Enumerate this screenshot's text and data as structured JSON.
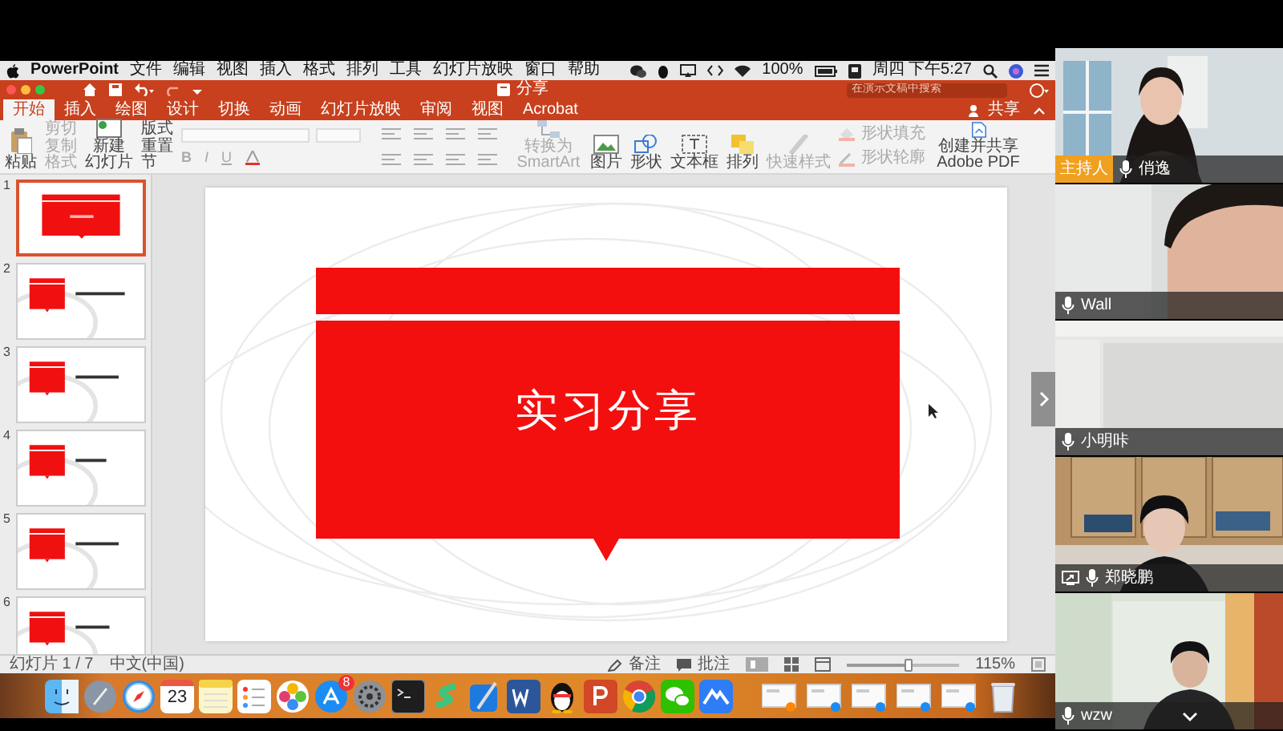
{
  "menubar": {
    "app": "PowerPoint",
    "menus": [
      "文件",
      "编辑",
      "视图",
      "插入",
      "格式",
      "排列",
      "工具",
      "幻灯片放映",
      "窗口",
      "帮助"
    ],
    "battery": "100%",
    "clock": "周四 下午5:27"
  },
  "titlebar": {
    "title": "分享",
    "search": {
      "placeholder": "在演示文稿中搜索"
    }
  },
  "tabs": [
    {
      "label": "开始",
      "selected": true
    },
    {
      "label": "插入",
      "selected": false
    },
    {
      "label": "绘图",
      "selected": false
    },
    {
      "label": "设计",
      "selected": false
    },
    {
      "label": "切换",
      "selected": false
    },
    {
      "label": "动画",
      "selected": false
    },
    {
      "label": "幻灯片放映",
      "selected": false
    },
    {
      "label": "审阅",
      "selected": false
    },
    {
      "label": "视图",
      "selected": false
    },
    {
      "label": "Acrobat",
      "selected": false
    }
  ],
  "share": "共享",
  "ribbon": {
    "paste": "粘贴",
    "clipboard": [
      "剪切",
      "复制",
      "格式"
    ],
    "new_slide": [
      "新建",
      "幻灯片"
    ],
    "slide_layout": [
      "版式",
      "重置",
      "节"
    ],
    "format_buttons": [
      "B",
      "I",
      "U"
    ],
    "smartart": "转换为 SmartArt",
    "insert": [
      "图片",
      "形状",
      "文本框"
    ],
    "arrange": "排列",
    "quick_styles": "快速样式",
    "shape_format": [
      "形状填充",
      "形状轮廓"
    ],
    "pdf": "创建并共享 Adobe PDF"
  },
  "slides": [
    {
      "number": "1",
      "selected": true
    },
    {
      "number": "2",
      "selected": false
    },
    {
      "number": "3",
      "selected": false
    },
    {
      "number": "4",
      "selected": false
    },
    {
      "number": "5",
      "selected": false
    },
    {
      "number": "6",
      "selected": false
    }
  ],
  "slide": {
    "title": "实习分享"
  },
  "status": {
    "position": "幻灯片 1 / 7",
    "language": "中文(中国)",
    "notes": "备注",
    "comments": "批注",
    "zoom": {
      "level": 0.55,
      "reading": "115%"
    }
  },
  "dock": {
    "calendar_day": "23",
    "app_store_badge": "8"
  },
  "participants": [
    {
      "name": "俏逸",
      "badge": "主持人",
      "sharing": false
    },
    {
      "name": "Wall",
      "sharing": false
    },
    {
      "name": "小明咔",
      "sharing": false
    },
    {
      "name": "郑晓鹏",
      "sharing": true
    },
    {
      "name": "wzw",
      "sharing": false
    }
  ]
}
